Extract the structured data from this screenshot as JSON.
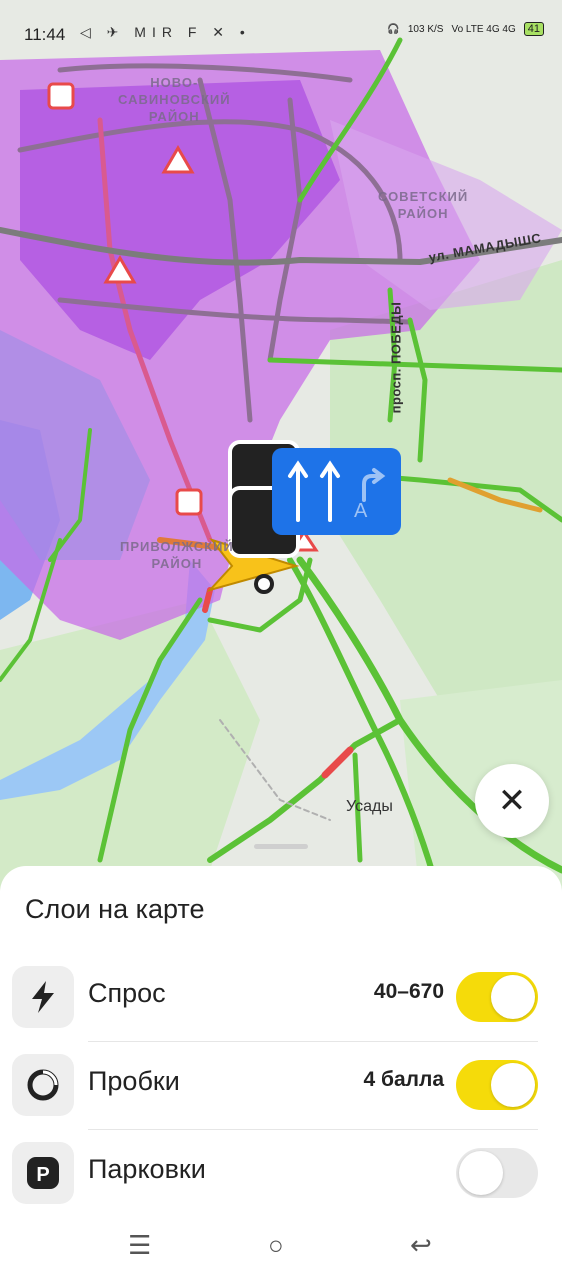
{
  "status_bar": {
    "time": "11:44",
    "icons": "◁ ✈ MIR F ✕ •",
    "speed": "103 K/S",
    "network": "Vo LTE 4G 4G",
    "battery": "41"
  },
  "map": {
    "districts": [
      "НОВО-\nСАВИНОВСКИЙ\nРАЙОН",
      "СОВЕТСКИЙ\nРАЙОН",
      "ПРИВОЛЖСКИЙ\nРАЙОН"
    ],
    "streets": [
      "ул. МАМАДЫШС",
      "просп. ПОБЕДЫ"
    ],
    "town": "Усады",
    "lane_letter": "А"
  },
  "sheet": {
    "title": "Слои на карте",
    "rows": [
      {
        "label": "Спрос",
        "value": "40–670",
        "enabled": true
      },
      {
        "label": "Пробки",
        "value": "4 балла",
        "enabled": true
      },
      {
        "label": "Парковки",
        "value": "",
        "enabled": false
      }
    ]
  },
  "colors": {
    "accent_toggle": "#f5db0a",
    "demand_purple": "#c86be8",
    "traffic_green": "#5bc236",
    "traffic_red": "#e84a4a",
    "lane_blue": "#1e73e8"
  }
}
